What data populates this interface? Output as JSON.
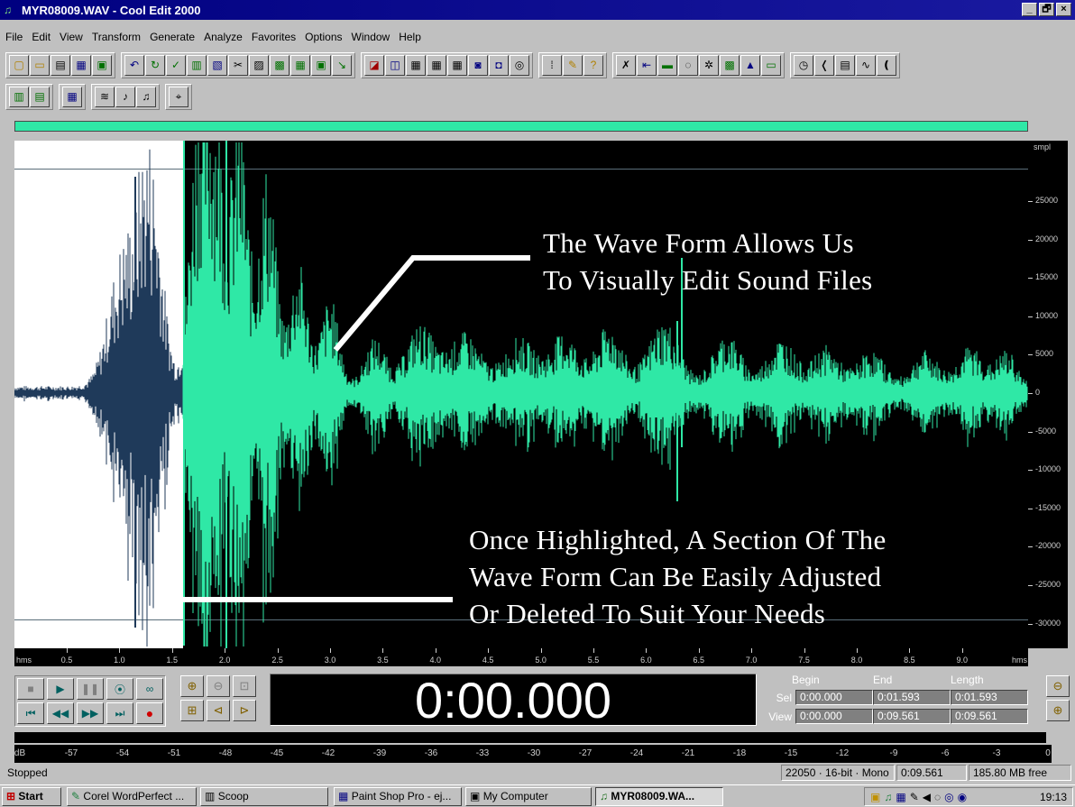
{
  "window": {
    "title": "MYR08009.WAV - Cool Edit 2000",
    "minimize": "_",
    "maximize": "🗗",
    "close": "×"
  },
  "menu": [
    "File",
    "Edit",
    "View",
    "Transform",
    "Generate",
    "Analyze",
    "Favorites",
    "Options",
    "Window",
    "Help"
  ],
  "annotations": {
    "top_line1": "The Wave Form Allows Us",
    "top_line2": "To Visually Edit Sound Files",
    "bottom_line1": "Once Highlighted, A Section Of The",
    "bottom_line2": "Wave Form Can Be Easily Adjusted",
    "bottom_line3": "Or Deleted To Suit Your Needs"
  },
  "amplitude_ruler": {
    "unit": "smpl",
    "labels": [
      "25000",
      "20000",
      "15000",
      "10000",
      "5000",
      "0",
      "-5000",
      "-10000",
      "-15000",
      "-20000",
      "-25000",
      "-30000"
    ]
  },
  "time_ruler": {
    "unit_left": "hms",
    "unit_right": "hms",
    "labels": [
      "0.5",
      "1.0",
      "1.5",
      "2.0",
      "2.5",
      "3.0",
      "3.5",
      "4.0",
      "4.5",
      "5.0",
      "5.5",
      "6.0",
      "6.5",
      "7.0",
      "7.5",
      "8.0",
      "8.5",
      "9.0"
    ]
  },
  "transport": {
    "stop": "■",
    "play": "▶",
    "pause": "❚❚",
    "play_to_end": "⦿",
    "loop": "∞",
    "go_start": "⏮",
    "rewind": "◀◀",
    "forward": "▶▶",
    "go_end": "⏭",
    "record": "●"
  },
  "timer": "0:00.000",
  "selection": {
    "headers": {
      "begin": "Begin",
      "end": "End",
      "length": "Length"
    },
    "sel_label": "Sel",
    "view_label": "View",
    "sel": {
      "begin": "0:00.000",
      "end": "0:01.593",
      "length": "0:01.593"
    },
    "view": {
      "begin": "0:00.000",
      "end": "0:09.561",
      "length": "0:09.561"
    }
  },
  "level_meter": {
    "labels": [
      "dB",
      "-57",
      "-54",
      "-51",
      "-48",
      "-45",
      "-42",
      "-39",
      "-36",
      "-33",
      "-30",
      "-27",
      "-24",
      "-21",
      "-18",
      "-15",
      "-12",
      "-9",
      "-6",
      "-3",
      "0"
    ]
  },
  "status": {
    "state": "Stopped",
    "format": "22050 · 16-bit · Mono",
    "duration": "0:09.561",
    "free": "185.80 MB free"
  },
  "taskbar": {
    "start": "Start",
    "tasks": [
      "Corel WordPerfect ...",
      "Scoop",
      "Paint Shop Pro - ej...",
      "My Computer",
      "MYR08009.WA..."
    ],
    "clock": "19:13"
  },
  "colors": {
    "waveform": "#2fe8a6",
    "waveform_selected": "#1f3a5a",
    "background": "#000000",
    "selection": "#ffffff",
    "title_bar": "#000080"
  }
}
